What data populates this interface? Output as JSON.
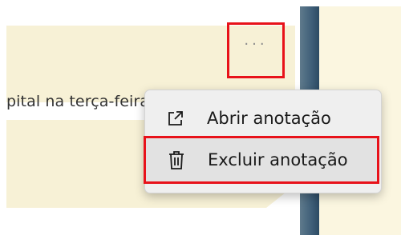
{
  "note_preview": {
    "text": "pital na terça-feira"
  },
  "note_toolbar": {
    "more_icon": "more-horizontal-icon"
  },
  "context_menu": {
    "items": [
      {
        "label": "Abrir anotação",
        "icon": "open-external-icon"
      },
      {
        "label": "Excluir anotação",
        "icon": "trash-icon"
      }
    ]
  },
  "colors": {
    "note_background": "#f7f1d6",
    "highlight_border": "#e8121a",
    "menu_background": "#efefef",
    "divider_blue": "#3f5f78"
  }
}
